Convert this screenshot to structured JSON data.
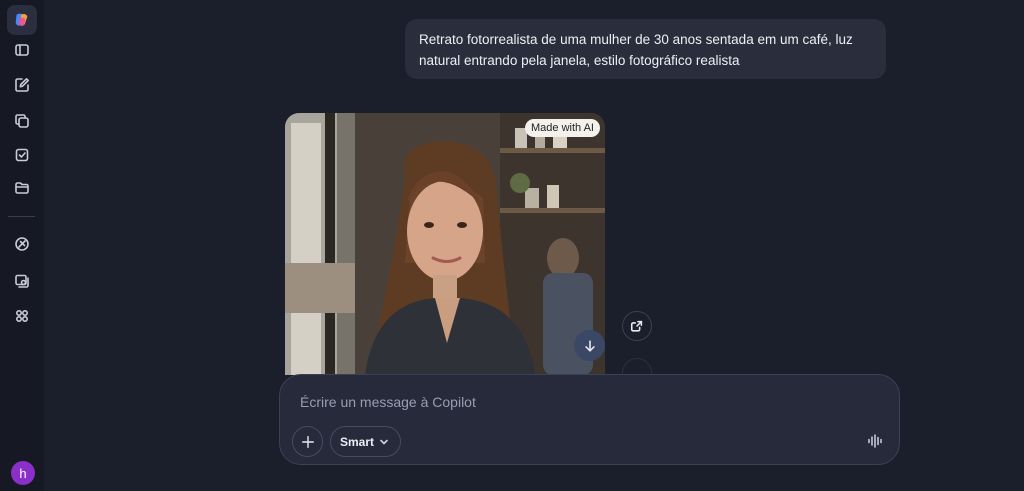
{
  "sidebar": {
    "items": [
      {
        "name": "copilot-logo-icon"
      },
      {
        "name": "sidebar-toggle-icon"
      },
      {
        "name": "new-chat-icon"
      },
      {
        "name": "pages-icon"
      },
      {
        "name": "tasks-icon"
      },
      {
        "name": "folder-icon"
      },
      {
        "name": "discover-icon"
      },
      {
        "name": "imagine-icon"
      },
      {
        "name": "apps-icon"
      }
    ],
    "avatar_initial": "h"
  },
  "conversation": {
    "user_message": "Retrato fotorrealista de uma mulher de 30 anos sentada em um café, luz natural entrando pela janela, estilo fotográfico realista",
    "image_badge": "Made with AI"
  },
  "composer": {
    "placeholder": "Écrire un message à Copilot",
    "mode_label": "Smart"
  },
  "colors": {
    "background": "#1b1e2b",
    "sidebar": "#161924",
    "composer": "#262a3b",
    "user_bubble": "#2a2e3c",
    "avatar": "#8b2fc9"
  }
}
